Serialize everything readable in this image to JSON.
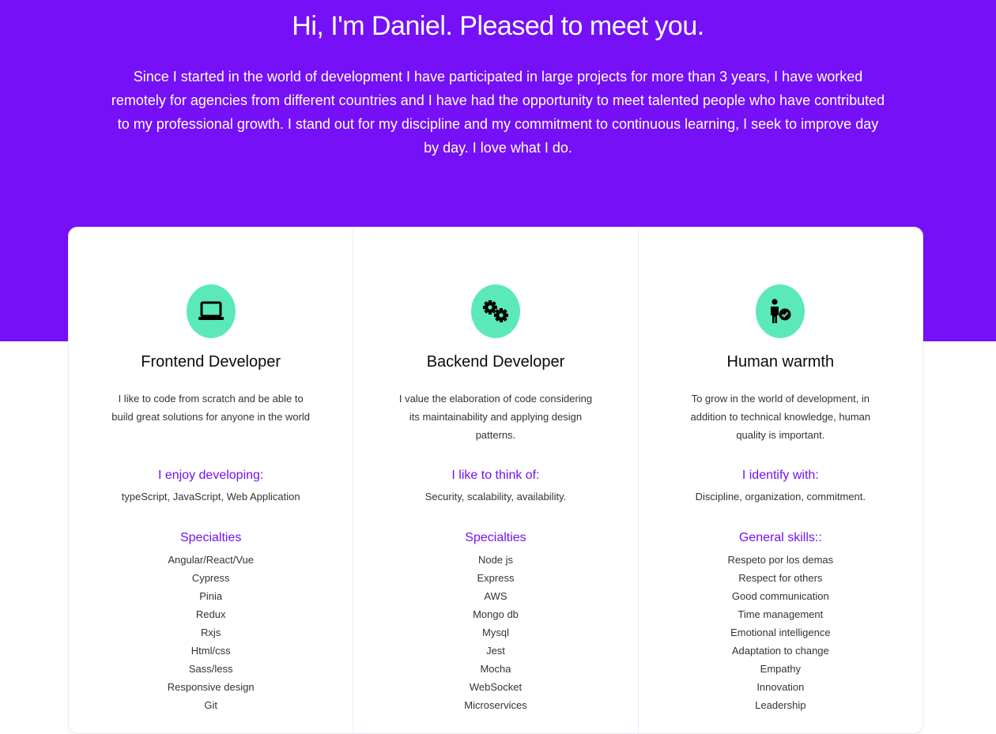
{
  "hero": {
    "title": "Hi, I'm Daniel. Pleased to meet you.",
    "intro": "Since I started in the world of development I have participated in large projects for more than 3 years, I have worked remotely for agencies from different countries and I have had the opportunity to meet talented people who have contributed to my professional growth. I stand out for my discipline and my commitment to continuous learning, I seek to improve day by day. I love what I do."
  },
  "colors": {
    "brand": "#7510f7",
    "icon_bg": "#5be9b9",
    "text": "#141c3a"
  },
  "cards": [
    {
      "icon": "laptop-icon",
      "title": "Frontend Developer",
      "description": "I like to code from scratch and be able to build great solutions for anyone in the world",
      "subtitle": "I enjoy developing:",
      "subtitle_text": "typeScript, JavaScript, Web Application",
      "list_title": "Specialties",
      "items": [
        "Angular/React/Vue",
        "Cypress",
        "Pinia",
        "Redux",
        "Rxjs",
        "Html/css",
        "Sass/less",
        "Responsive design",
        "Git"
      ]
    },
    {
      "icon": "gears-icon",
      "title": "Backend Developer",
      "description": "I value the elaboration of code considering its maintainability and applying design patterns.",
      "subtitle": "I like to think of:",
      "subtitle_text": "Security, scalability, availability.",
      "list_title": "Specialties",
      "items": [
        "Node js",
        "Express",
        "AWS",
        "Mongo db",
        "Mysql",
        "Jest",
        "Mocha",
        "WebSocket",
        "Microservices"
      ]
    },
    {
      "icon": "person-check-icon",
      "title": "Human warmth",
      "description": "To grow in the world of development, in addition to technical knowledge, human quality is important.",
      "subtitle": "I identify with:",
      "subtitle_text": "Discipline, organization, commitment.",
      "list_title": "General skills::",
      "items": [
        "Respeto por los demas",
        "Respect for others",
        "Good communication",
        "Time management",
        "Emotional intelligence",
        "Adaptation to change",
        "Empathy",
        "Innovation",
        "Leadership"
      ]
    }
  ]
}
